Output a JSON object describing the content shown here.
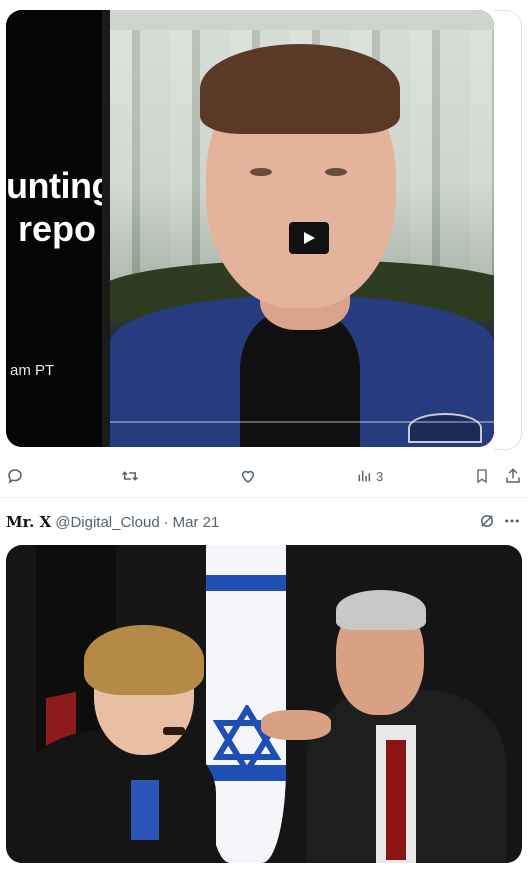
{
  "media_top": {
    "clip_text_1": "unting",
    "clip_text_2": "; repo",
    "clip_text_3": "am PT"
  },
  "actions": {
    "views_count": "3"
  },
  "tweet": {
    "display_name": "Mr. X",
    "handle": "@Digital_Cloud",
    "separator": "·",
    "date": "Mar 21"
  },
  "icons": {
    "reply": "reply-icon",
    "retweet": "retweet-icon",
    "like": "heart-icon",
    "views": "analytics-icon",
    "bookmark": "bookmark-icon",
    "share": "share-icon",
    "grok": "grok-icon",
    "more": "more-icon",
    "play": "play-icon"
  },
  "colors": {
    "icon_gray": "#536471",
    "text_primary": "#0f1419",
    "divider": "#eff3f4"
  }
}
